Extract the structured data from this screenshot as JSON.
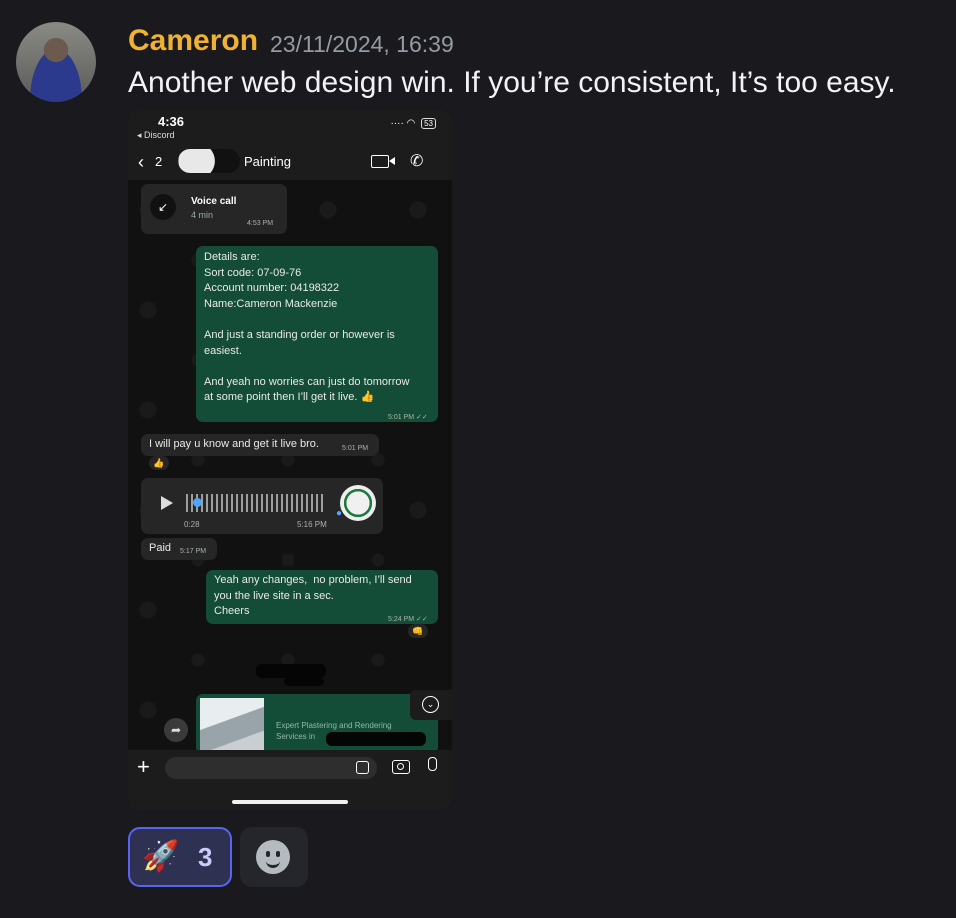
{
  "message": {
    "author": "Cameron",
    "timestamp": "23/11/2024, 16:39",
    "text": "Another web design win. If you’re consistent, It’s too easy."
  },
  "colors": {
    "author": "#f0b232",
    "reaction_border": "#5865f2",
    "outgoing_bubble": "#144d37"
  },
  "screenshot": {
    "status_time": "4:36",
    "status_back": "◂ Discord",
    "battery": "53",
    "chat_back_count": "2",
    "contact_name": "Painting",
    "voice_call": {
      "title": "Voice call",
      "duration": "4 min",
      "time": "4:53 PM"
    },
    "details_message": {
      "lines": [
        "Details are:",
        "Sort code: 07-09-76",
        "Account number: 04198322",
        "Name:Cameron Mackenzie",
        "",
        "And just a standing order or however is",
        "easiest.",
        "",
        "And yeah no worries can just do tomorrow",
        "at some point then I’ll get it live. 👍"
      ],
      "time": "5:01 PM ✓✓"
    },
    "reply_1": {
      "text": "I will pay u know and get it live bro.",
      "time": "5:01 PM",
      "reaction": "👍"
    },
    "voice_note": {
      "duration": "0:28",
      "time": "5:16 PM"
    },
    "reply_2": {
      "text": "Paid",
      "time": "5:17 PM"
    },
    "confirm_message": {
      "lines": [
        "Yeah any changes,  no problem, I’ll send",
        "you the live site in a sec.",
        "Cheers"
      ],
      "time": "5:24 PM ✓✓",
      "reaction": "👊"
    },
    "link_preview_text": "Expert Plastering and Rendering Services in"
  },
  "reactions": [
    {
      "emoji": "🚀",
      "count": "3"
    }
  ],
  "icons": [
    "avatar",
    "video-icon",
    "phone-icon",
    "play-icon",
    "forward-icon",
    "scroll-down-icon",
    "plus-icon",
    "sticker-icon",
    "camera-icon",
    "mic-icon",
    "add-reaction-icon"
  ]
}
